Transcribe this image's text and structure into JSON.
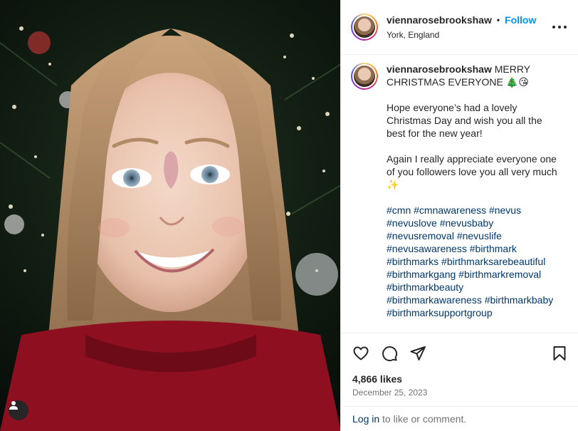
{
  "post": {
    "username": "viennarosebrookshaw",
    "separator": "•",
    "follow_label": "Follow",
    "location": "York, England",
    "caption": {
      "username": "viennarosebrookshaw",
      "headline": "MERRY CHRISTMAS EVERYONE 🎄😘",
      "paragraph1": "Hope everyone’s had a lovely Christmas Day and wish you all the best for the new year!",
      "paragraph2": "Again I really appreciate everyone one of you followers love you all very much ✨",
      "hashtags": [
        "#cmn",
        "#cmnawareness",
        "#nevus",
        "#nevuslove",
        "#nevusbaby",
        "#nevusremoval",
        "#nevuslife",
        "#nevusawareness",
        "#birthmark",
        "#birthmarks",
        "#birthmarksarebeautiful",
        "#birthmarkgang",
        "#birthmarkremoval",
        "#birthmarkbeauty",
        "#birthmarkawareness",
        "#birthmarkbaby",
        "#birthmarksupportgroup"
      ]
    },
    "likes": "4,866 likes",
    "date": "December 25, 2023"
  },
  "login": {
    "link": "Log in",
    "rest": " to like or comment."
  },
  "icons": {
    "like": "heart-icon",
    "comment": "comment-icon",
    "share": "share-icon",
    "save": "bookmark-icon",
    "more": "more-icon",
    "tag": "user-tag-icon"
  },
  "colors": {
    "link_blue": "#0095f6",
    "hashtag": "#00376b",
    "text": "#262626",
    "muted": "#737373",
    "divider": "#efefef"
  }
}
